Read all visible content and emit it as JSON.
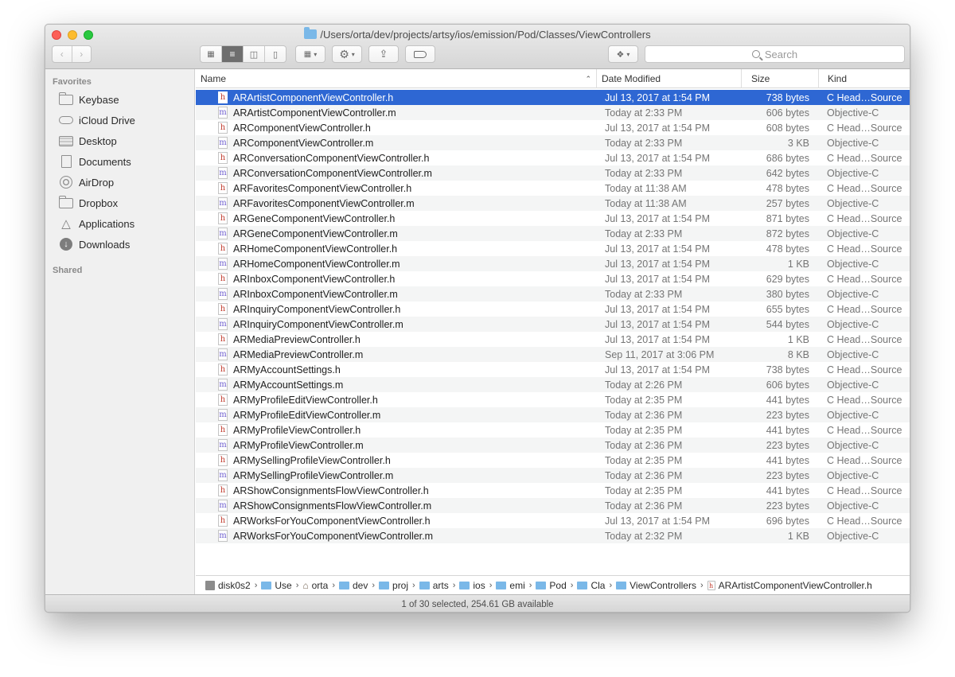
{
  "window": {
    "title": "/Users/orta/dev/projects/artsy/ios/emission/Pod/Classes/ViewControllers"
  },
  "toolbar": {
    "back_icon": "chevron-left-icon",
    "forward_icon": "chevron-right-icon",
    "view_modes": [
      "icon-view",
      "list-view",
      "column-view",
      "cover-flow-view"
    ],
    "active_view": "list-view",
    "search_placeholder": "Search"
  },
  "sidebar": {
    "favorites_heading": "Favorites",
    "items": [
      {
        "label": "Keybase",
        "icon": "folder-icon"
      },
      {
        "label": "iCloud Drive",
        "icon": "cloud-icon"
      },
      {
        "label": "Desktop",
        "icon": "desktop-icon"
      },
      {
        "label": "Documents",
        "icon": "document-icon"
      },
      {
        "label": "AirDrop",
        "icon": "airdrop-icon"
      },
      {
        "label": "Dropbox",
        "icon": "folder-icon"
      },
      {
        "label": "Applications",
        "icon": "applications-icon"
      },
      {
        "label": "Downloads",
        "icon": "download-icon"
      }
    ],
    "shared_heading": "Shared"
  },
  "list": {
    "columns": {
      "name": "Name",
      "date": "Date Modified",
      "size": "Size",
      "kind": "Kind"
    },
    "rows": [
      {
        "type": "h",
        "name": "ARArtistComponentViewController.h",
        "date": "Jul 13, 2017 at 1:54 PM",
        "size": "738 bytes",
        "kind": "C Head…Source"
      },
      {
        "type": "m",
        "name": "ARArtistComponentViewController.m",
        "date": "Today at 2:33 PM",
        "size": "606 bytes",
        "kind": "Objective-C"
      },
      {
        "type": "h",
        "name": "ARComponentViewController.h",
        "date": "Jul 13, 2017 at 1:54 PM",
        "size": "608 bytes",
        "kind": "C Head…Source"
      },
      {
        "type": "m",
        "name": "ARComponentViewController.m",
        "date": "Today at 2:33 PM",
        "size": "3 KB",
        "kind": "Objective-C"
      },
      {
        "type": "h",
        "name": "ARConversationComponentViewController.h",
        "date": "Jul 13, 2017 at 1:54 PM",
        "size": "686 bytes",
        "kind": "C Head…Source"
      },
      {
        "type": "m",
        "name": "ARConversationComponentViewController.m",
        "date": "Today at 2:33 PM",
        "size": "642 bytes",
        "kind": "Objective-C"
      },
      {
        "type": "h",
        "name": "ARFavoritesComponentViewController.h",
        "date": "Today at 11:38 AM",
        "size": "478 bytes",
        "kind": "C Head…Source"
      },
      {
        "type": "m",
        "name": "ARFavoritesComponentViewController.m",
        "date": "Today at 11:38 AM",
        "size": "257 bytes",
        "kind": "Objective-C"
      },
      {
        "type": "h",
        "name": "ARGeneComponentViewController.h",
        "date": "Jul 13, 2017 at 1:54 PM",
        "size": "871 bytes",
        "kind": "C Head…Source"
      },
      {
        "type": "m",
        "name": "ARGeneComponentViewController.m",
        "date": "Today at 2:33 PM",
        "size": "872 bytes",
        "kind": "Objective-C"
      },
      {
        "type": "h",
        "name": "ARHomeComponentViewController.h",
        "date": "Jul 13, 2017 at 1:54 PM",
        "size": "478 bytes",
        "kind": "C Head…Source"
      },
      {
        "type": "m",
        "name": "ARHomeComponentViewController.m",
        "date": "Jul 13, 2017 at 1:54 PM",
        "size": "1 KB",
        "kind": "Objective-C"
      },
      {
        "type": "h",
        "name": "ARInboxComponentViewController.h",
        "date": "Jul 13, 2017 at 1:54 PM",
        "size": "629 bytes",
        "kind": "C Head…Source"
      },
      {
        "type": "m",
        "name": "ARInboxComponentViewController.m",
        "date": "Today at 2:33 PM",
        "size": "380 bytes",
        "kind": "Objective-C"
      },
      {
        "type": "h",
        "name": "ARInquiryComponentViewController.h",
        "date": "Jul 13, 2017 at 1:54 PM",
        "size": "655 bytes",
        "kind": "C Head…Source"
      },
      {
        "type": "m",
        "name": "ARInquiryComponentViewController.m",
        "date": "Jul 13, 2017 at 1:54 PM",
        "size": "544 bytes",
        "kind": "Objective-C"
      },
      {
        "type": "h",
        "name": "ARMediaPreviewController.h",
        "date": "Jul 13, 2017 at 1:54 PM",
        "size": "1 KB",
        "kind": "C Head…Source"
      },
      {
        "type": "m",
        "name": "ARMediaPreviewController.m",
        "date": "Sep 11, 2017 at 3:06 PM",
        "size": "8 KB",
        "kind": "Objective-C"
      },
      {
        "type": "h",
        "name": "ARMyAccountSettings.h",
        "date": "Jul 13, 2017 at 1:54 PM",
        "size": "738 bytes",
        "kind": "C Head…Source"
      },
      {
        "type": "m",
        "name": "ARMyAccountSettings.m",
        "date": "Today at 2:26 PM",
        "size": "606 bytes",
        "kind": "Objective-C"
      },
      {
        "type": "h",
        "name": "ARMyProfileEditViewController.h",
        "date": "Today at 2:35 PM",
        "size": "441 bytes",
        "kind": "C Head…Source"
      },
      {
        "type": "m",
        "name": "ARMyProfileEditViewController.m",
        "date": "Today at 2:36 PM",
        "size": "223 bytes",
        "kind": "Objective-C"
      },
      {
        "type": "h",
        "name": "ARMyProfileViewController.h",
        "date": "Today at 2:35 PM",
        "size": "441 bytes",
        "kind": "C Head…Source"
      },
      {
        "type": "m",
        "name": "ARMyProfileViewController.m",
        "date": "Today at 2:36 PM",
        "size": "223 bytes",
        "kind": "Objective-C"
      },
      {
        "type": "h",
        "name": "ARMySellingProfileViewController.h",
        "date": "Today at 2:35 PM",
        "size": "441 bytes",
        "kind": "C Head…Source"
      },
      {
        "type": "m",
        "name": "ARMySellingProfileViewController.m",
        "date": "Today at 2:36 PM",
        "size": "223 bytes",
        "kind": "Objective-C"
      },
      {
        "type": "h",
        "name": "ARShowConsignmentsFlowViewController.h",
        "date": "Today at 2:35 PM",
        "size": "441 bytes",
        "kind": "C Head…Source"
      },
      {
        "type": "m",
        "name": "ARShowConsignmentsFlowViewController.m",
        "date": "Today at 2:36 PM",
        "size": "223 bytes",
        "kind": "Objective-C"
      },
      {
        "type": "h",
        "name": "ARWorksForYouComponentViewController.h",
        "date": "Jul 13, 2017 at 1:54 PM",
        "size": "696 bytes",
        "kind": "C Head…Source"
      },
      {
        "type": "m",
        "name": "ARWorksForYouComponentViewController.m",
        "date": "Today at 2:32 PM",
        "size": "1 KB",
        "kind": "Objective-C"
      }
    ]
  },
  "pathbar": {
    "crumbs": [
      {
        "label": "disk0s2",
        "icon": "disk"
      },
      {
        "label": "Use",
        "icon": "folder"
      },
      {
        "label": "orta",
        "icon": "home"
      },
      {
        "label": "dev",
        "icon": "folder"
      },
      {
        "label": "proj",
        "icon": "folder"
      },
      {
        "label": "arts",
        "icon": "folder"
      },
      {
        "label": "ios",
        "icon": "folder"
      },
      {
        "label": "emi",
        "icon": "folder"
      },
      {
        "label": "Pod",
        "icon": "folder"
      },
      {
        "label": "Cla",
        "icon": "folder"
      },
      {
        "label": "ViewControllers",
        "icon": "folder"
      },
      {
        "label": "ARArtistComponentViewController.h",
        "icon": "file"
      }
    ]
  },
  "status": {
    "text": "1 of 30 selected, 254.61 GB available"
  },
  "colors": {
    "selection": "#2e67d3",
    "folder_blue": "#7ab8e8",
    "close": "#fc5f57",
    "minimize": "#fdbc2e",
    "maximize": "#29c840"
  }
}
